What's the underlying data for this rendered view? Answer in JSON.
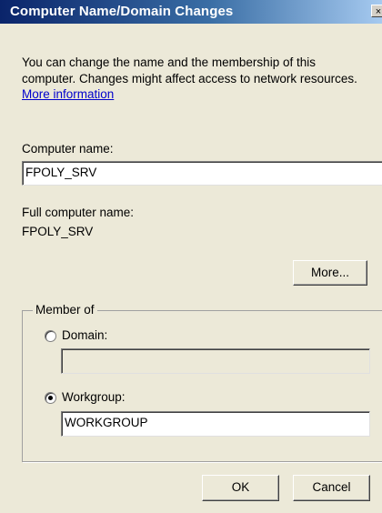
{
  "window": {
    "title": "Computer Name/Domain Changes",
    "close_label": "×"
  },
  "intro": {
    "line1": "You can change the name and the membership of this",
    "line2": "computer. Changes might affect access to network resources.",
    "link": "More information"
  },
  "computer_name": {
    "label": "Computer name:",
    "value": "FPOLY_SRV"
  },
  "full_computer_name": {
    "label": "Full computer name:",
    "value": "FPOLY_SRV"
  },
  "buttons": {
    "more": "More...",
    "ok": "OK",
    "cancel": "Cancel"
  },
  "member_of": {
    "legend": "Member of",
    "domain_label": "Domain:",
    "domain_value": "",
    "domain_selected": false,
    "workgroup_label": "Workgroup:",
    "workgroup_value": "WORKGROUP",
    "workgroup_selected": true
  },
  "colors": {
    "title_gradient_start": "#0a246a",
    "title_gradient_end": "#a6caf0",
    "dialog_background": "#ece9d8",
    "link": "#0000cc"
  }
}
